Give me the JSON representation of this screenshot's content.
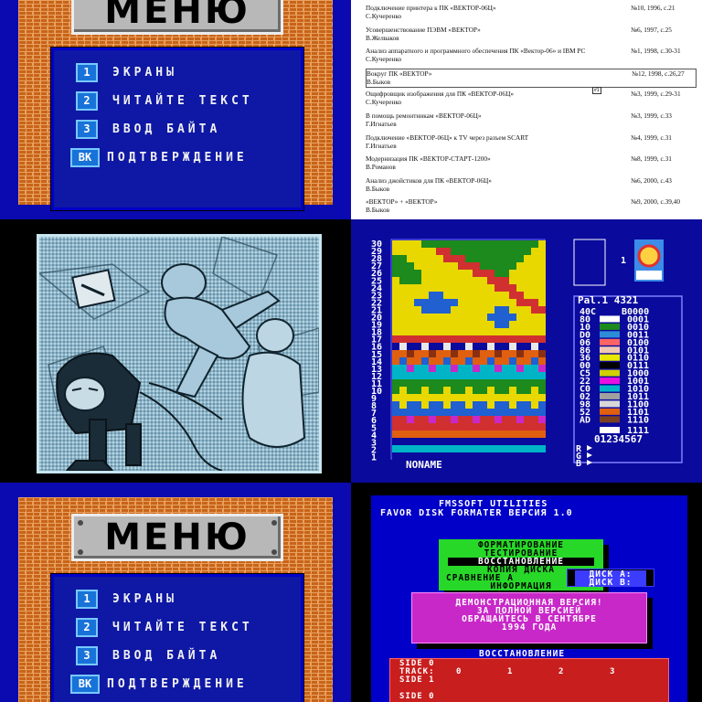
{
  "menu": {
    "title": "МЕНЮ",
    "items": [
      {
        "key": "1",
        "label": "ЭКРАНЫ"
      },
      {
        "key": "2",
        "label": "ЧИТАЙТЕ ТЕКСТ"
      },
      {
        "key": "3",
        "label": "ВВОД БАЙТА"
      },
      {
        "key": "ВК",
        "label": "ПОДТВЕРЖДЕНИЕ"
      }
    ]
  },
  "document": {
    "articles": [
      {
        "title": "Подключение принтера к ПК «ВЕКТОР-06Ц»",
        "ref": "№10, 1996, с.21",
        "author": "С.Кучеренко"
      },
      {
        "title": "Усовершенствование ПЭВМ «ВЕКТОР»",
        "ref": "№6, 1997, с.25",
        "author": "В.Желваков"
      },
      {
        "title": "Анализ аппаратного и программного обеспечения ПК «Вектор-06» и IBM PC",
        "ref": "№1, 1998, с.30-31",
        "author": "С.Кучеренко"
      },
      {
        "title": "Вокруг ПК «ВЕКТОР»",
        "ref": "№12, 1998, с.26,27",
        "author": "В.Быков"
      },
      {
        "title": "Ощифровщик изображения для ПК «ВЕКТОР-06Ц»",
        "ref": "№3, 1999, с.29-31",
        "author": "С.Кучеренко"
      },
      {
        "title": "В помощь ремонтникам «ВЕКТОР-06Ц»",
        "ref": "№3, 1999, с.33",
        "author": "Г.Игнатьев"
      },
      {
        "title": "Подключение «ВЕКТОР-06Ц» к TV через разъем SCART",
        "ref": "№4, 1999, с.31",
        "author": "Г.Игнатьев"
      },
      {
        "title": "Модернизация ПК «ВЕКТОР-СТАРТ-1200»",
        "ref": "№8, 1999, с.31",
        "author": "В.Романов"
      },
      {
        "title": "Анализ джойстиков для ПК «ВЕКТОР-06Ц»",
        "ref": "№6, 2000, с.43",
        "author": "В.Быков"
      },
      {
        "title": "«ВЕКТОР» + «ВЕКТОР»",
        "ref": "№9, 2000, с.39,40",
        "author": "В.Быков"
      }
    ],
    "highlighted_index": 3,
    "marker": "#1"
  },
  "editor": {
    "rows": [
      "30",
      "29",
      "28",
      "27",
      "26",
      "25",
      "24",
      "23",
      "22",
      "21",
      "20",
      "19",
      "18",
      "17",
      "16",
      "15",
      "14",
      "13",
      "12",
      "11",
      "10",
      "9",
      "8",
      "7",
      "6",
      "5",
      "4",
      "3",
      "2",
      "1"
    ],
    "filename": "NONAME",
    "page_number": "1",
    "palette_title": "Pal.1 4321",
    "palette": [
      {
        "code": "40C",
        "bits": "B0000",
        "color": "#0a0a9c"
      },
      {
        "code": "80",
        "bits": "0001",
        "color": "#ffffff"
      },
      {
        "code": "10",
        "bits": "0010",
        "color": "#1c8a1c"
      },
      {
        "code": "D0",
        "bits": "0011",
        "color": "#2c8cd8"
      },
      {
        "code": "06",
        "bits": "0100",
        "color": "#ff6464"
      },
      {
        "code": "86",
        "bits": "0101",
        "color": "#f0c8b4"
      },
      {
        "code": "36",
        "bits": "0110",
        "color": "#e8e800"
      },
      {
        "code": "00",
        "bits": "0111",
        "color": "#000000"
      },
      {
        "code": "C5",
        "bits": "1000",
        "color": "#d0d000"
      },
      {
        "code": "22",
        "bits": "1001",
        "color": "#e810e0"
      },
      {
        "code": "C0",
        "bits": "1010",
        "color": "#00b4c8"
      },
      {
        "code": "02",
        "bits": "1011",
        "color": "#a0a0a0"
      },
      {
        "code": "98",
        "bits": "1100",
        "color": "#d8d8d8"
      },
      {
        "code": "52",
        "bits": "1101",
        "color": "#e06010"
      },
      {
        "code": "AD",
        "bits": "1110",
        "color": "#7a4020"
      }
    ],
    "palette_last_bits": "1111",
    "digits": "01234567",
    "channels": [
      "R",
      "G",
      "B"
    ]
  },
  "formatter": {
    "title1": "FMSSOFT UTILITIES",
    "title2": "FAVOR DISK FORMATER ВЕРСИЯ 1.0",
    "menu_items": [
      "ФОРМАТИРОВАНИЕ",
      "ТЕСТИРОВАНИЕ",
      "ВОССТАНОВЛЕНИЕ",
      "КОПИЯ ДИСКА",
      "СРАВНЕНИЕ А",
      "ИНФОРМАЦИЯ"
    ],
    "selected_item": 2,
    "disks": [
      "ДИСК А:",
      "ДИСК В:"
    ],
    "notice": [
      "ДЕМОНСТРАЦИОННАЯ ВЕРСИЯ!",
      "ЗА ПОЛНОЙ ВЕРСИЕЙ",
      "ОБРАЩАЙТЕСЬ В СЕНТЯБРЕ",
      "1994 ГОДА"
    ],
    "section": "ВОССТАНОВЛЕНИЕ",
    "side_a": "SIDE 0",
    "track_label": "TRACK:",
    "tracks": [
      "0",
      "1",
      "2",
      "3"
    ],
    "side_b": "SIDE 1",
    "side_c": "SIDE 0"
  }
}
